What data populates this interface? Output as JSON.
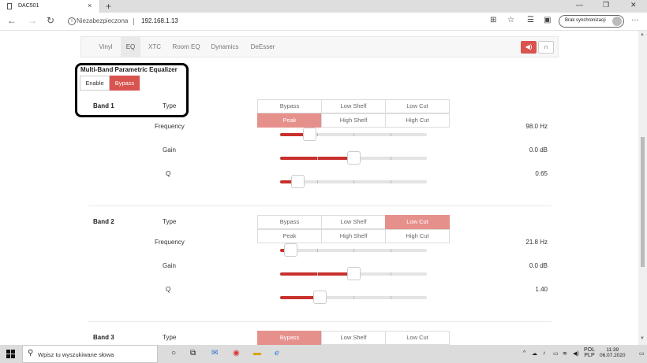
{
  "browser": {
    "tab_title": "DAC501",
    "new_tab": "+",
    "tab_close": "×",
    "win_min": "—",
    "win_max": "❐",
    "win_close": "✕",
    "security_text": "Niezabezpieczona",
    "url": "192.168.1.13",
    "sync_label": "Brak synchronizacji",
    "more": "···"
  },
  "nav": {
    "tabs": [
      "Vinyl",
      "EQ",
      "XTC",
      "Room EQ",
      "Dynamics",
      "DeEsser"
    ],
    "active_tab": "EQ",
    "output_speaker_icon": "speaker-icon",
    "output_headphones_icon": "headphones-icon"
  },
  "eq": {
    "title": "Multi-Band Parametric Equalizer",
    "enable_label": "Enable",
    "bypass_label": "Bypass",
    "type_options": [
      "Bypass",
      "Low Shelf",
      "Low Cut",
      "Peak",
      "High Shelf",
      "High Cut"
    ],
    "labels": {
      "type": "Type",
      "frequency": "Frequency",
      "gain": "Gain",
      "q": "Q"
    },
    "bands": [
      {
        "name": "Band 1",
        "type": "Peak",
        "frequency": "98.0 Hz",
        "gain": "0.0 dB",
        "q": "0.65",
        "frequency_level": 0.2,
        "gain_level": 0.5,
        "q_level": 0.12
      },
      {
        "name": "Band 2",
        "type": "Low Cut",
        "frequency": "21.8 Hz",
        "gain": "0.0 dB",
        "q": "1.40",
        "frequency_level": 0.07,
        "gain_level": 0.5,
        "q_level": 0.27
      },
      {
        "name": "Band 3",
        "type": "Bypass"
      }
    ]
  },
  "taskbar": {
    "search_placeholder": "Wpisz tu wyszukiwane słowa",
    "lang_top": "POL",
    "lang_bottom": "PLP",
    "time": "11:39",
    "date": "06.07.2020"
  },
  "colors": {
    "accent": "#d9534f",
    "selected": "#e6908c",
    "slider_fill": "#c9302c"
  }
}
